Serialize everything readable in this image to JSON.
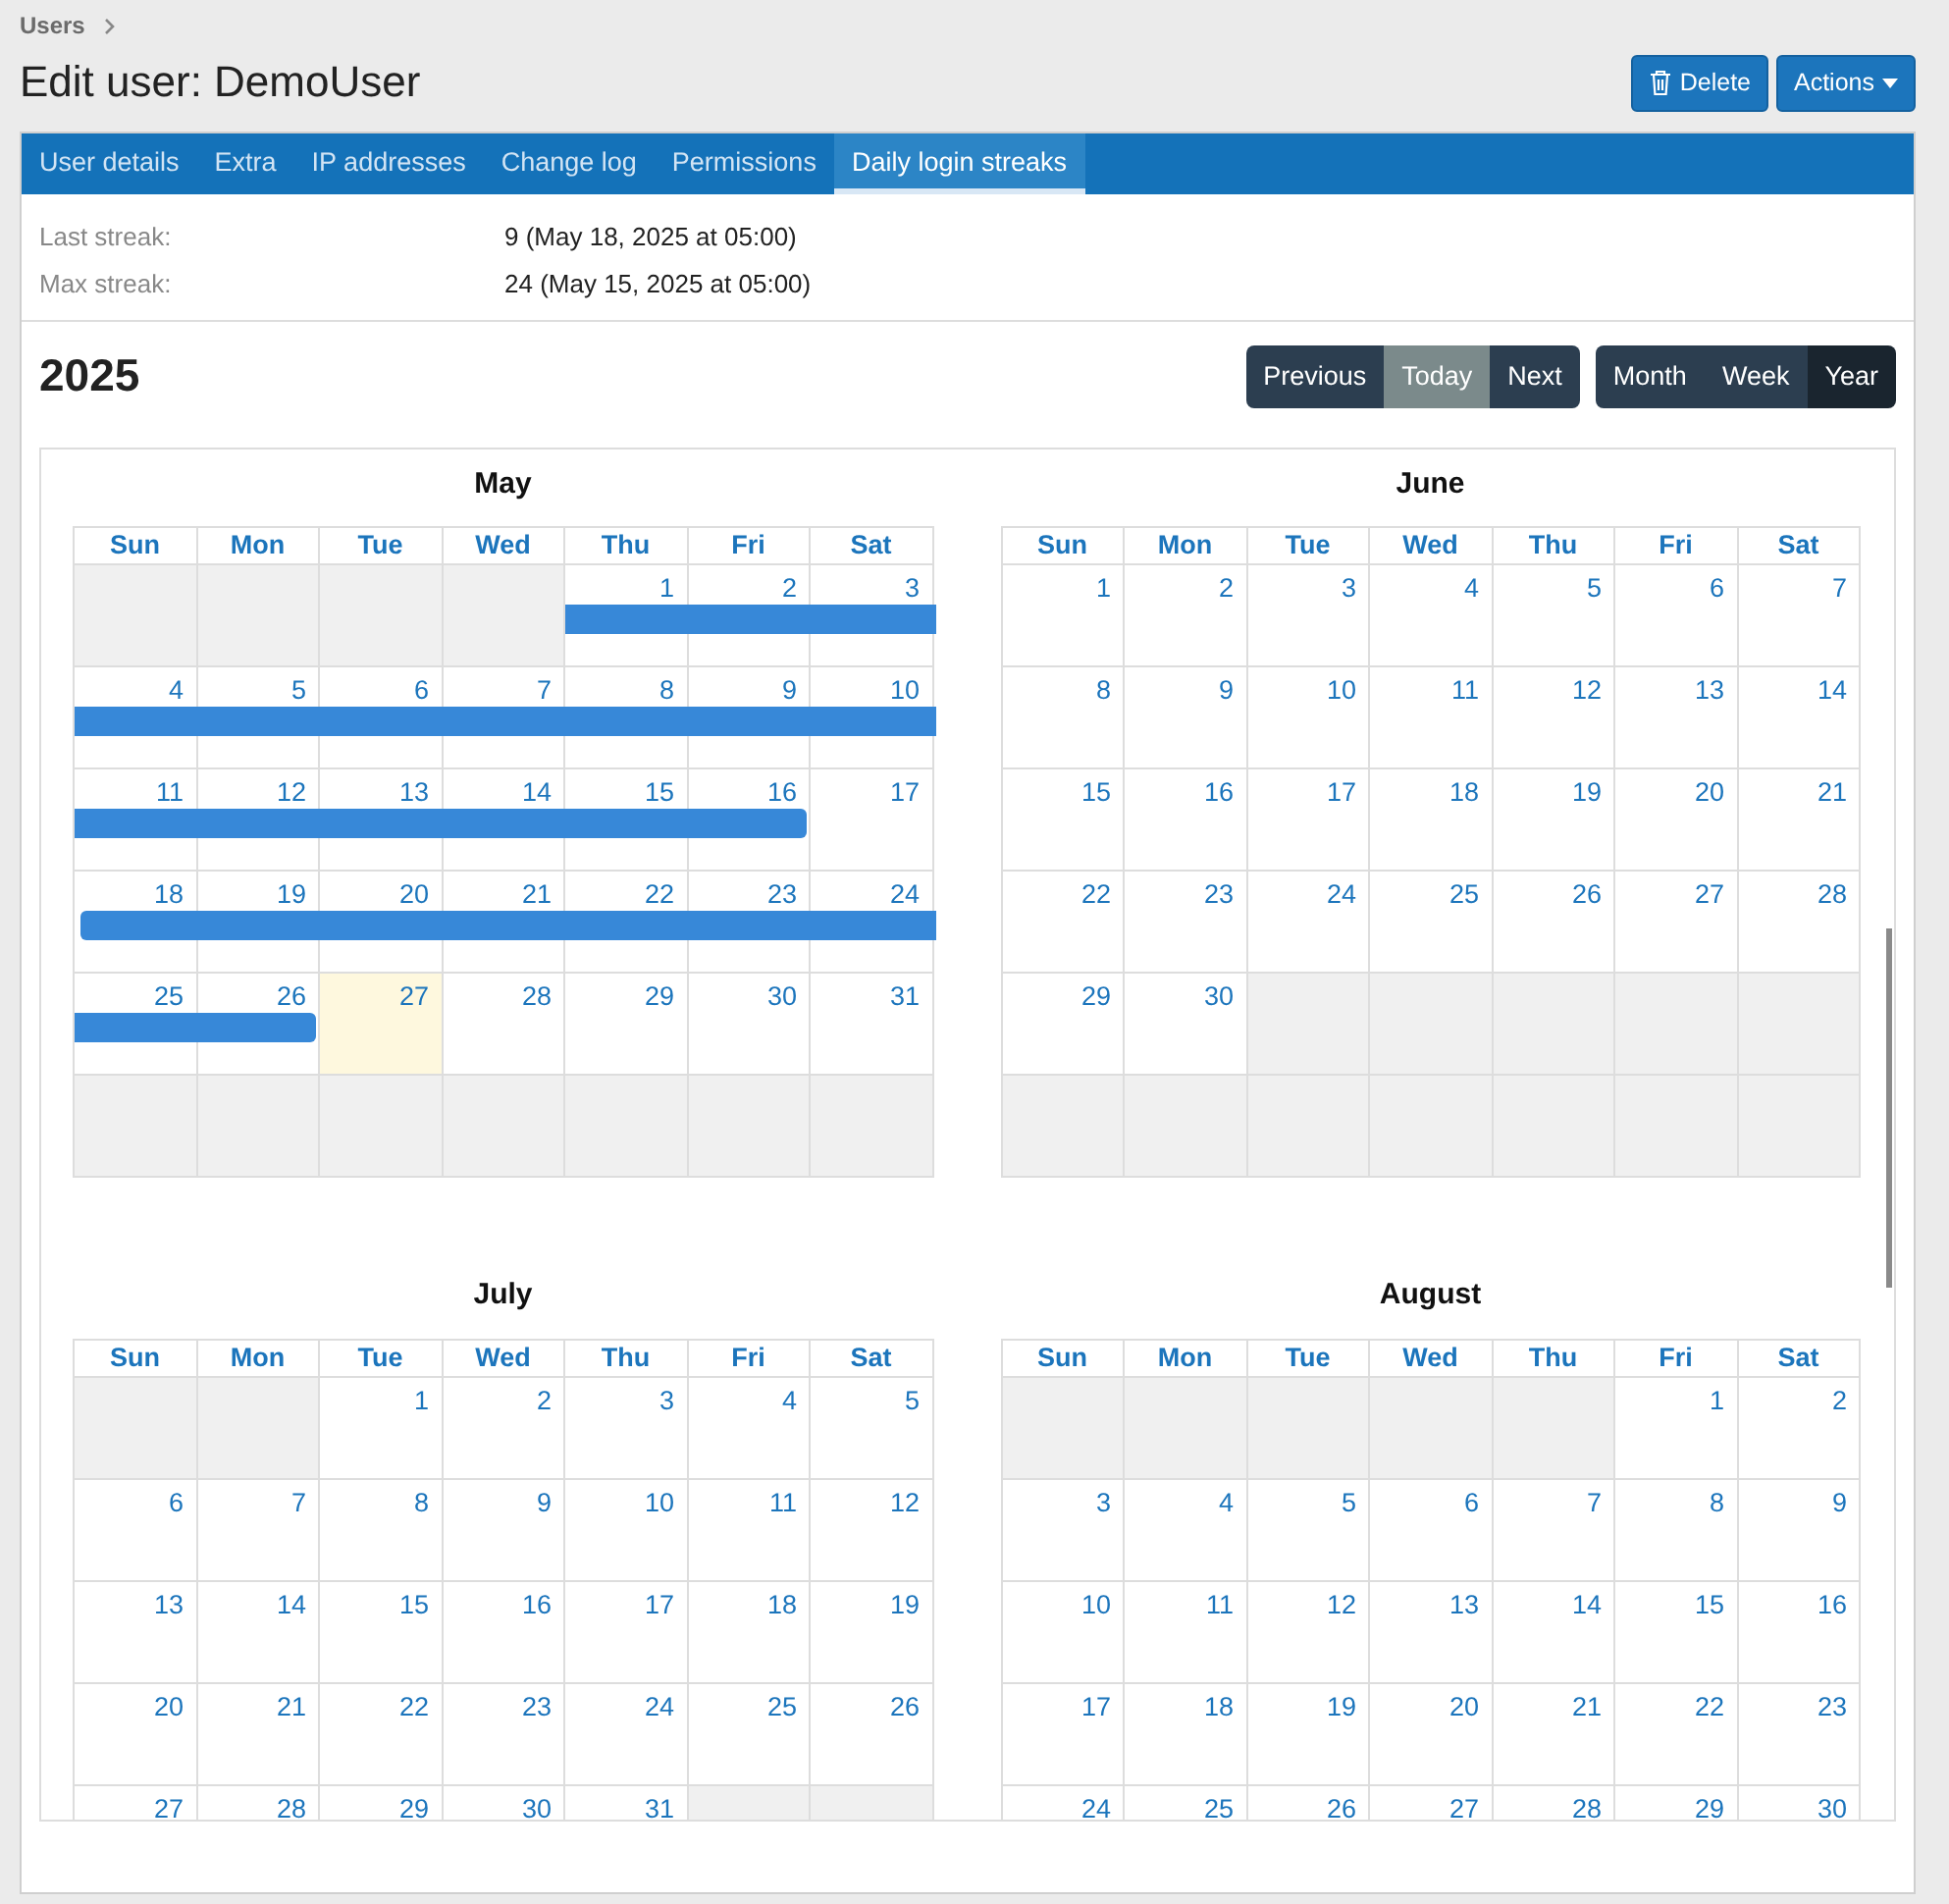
{
  "breadcrumb": {
    "label": "Users"
  },
  "title": "Edit user: DemoUser",
  "header_buttons": [
    {
      "label": "Delete",
      "kind": "delete"
    },
    {
      "label": "Actions",
      "kind": "dropdown"
    }
  ],
  "tabs": [
    {
      "label": "User details",
      "selected": false
    },
    {
      "label": "Extra",
      "selected": false
    },
    {
      "label": "IP addresses",
      "selected": false
    },
    {
      "label": "Change log",
      "selected": false
    },
    {
      "label": "Permissions",
      "selected": false
    },
    {
      "label": "Daily login streaks",
      "selected": true
    }
  ],
  "info": [
    {
      "label": "Last streak:",
      "value": "9 (May 18, 2025 at 05:00)"
    },
    {
      "label": "Max streak:",
      "value": "24 (May 15, 2025 at 05:00)"
    }
  ],
  "calendar": {
    "title": "2025",
    "nav_buttons": [
      {
        "label": "Previous",
        "disabled": false
      },
      {
        "label": "Today",
        "disabled": true
      },
      {
        "label": "Next",
        "disabled": false
      }
    ],
    "view_buttons": [
      {
        "label": "Month",
        "selected": false
      },
      {
        "label": "Week",
        "selected": false
      },
      {
        "label": "Year",
        "selected": true
      }
    ],
    "months": [
      {
        "name": "May",
        "weekdays": [
          "Sun",
          "Mon",
          "Tue",
          "Wed",
          "Thu",
          "Fri",
          "Sat"
        ],
        "weeks": [
          [
            {
              "kind": "blank"
            },
            {
              "kind": "blank"
            },
            {
              "kind": "blank"
            },
            {
              "kind": "blank"
            },
            {
              "kind": "day",
              "day": "1",
              "streak": true,
              "today": false
            },
            {
              "kind": "day",
              "day": "2",
              "streak": true,
              "today": false
            },
            {
              "kind": "day",
              "day": "3",
              "streak": true,
              "today": false
            }
          ],
          [
            {
              "kind": "day",
              "day": "4",
              "streak": true,
              "today": false
            },
            {
              "kind": "day",
              "day": "5",
              "streak": true,
              "today": false
            },
            {
              "kind": "day",
              "day": "6",
              "streak": true,
              "today": false
            },
            {
              "kind": "day",
              "day": "7",
              "streak": true,
              "today": false
            },
            {
              "kind": "day",
              "day": "8",
              "streak": true,
              "today": false
            },
            {
              "kind": "day",
              "day": "9",
              "streak": true,
              "today": false
            },
            {
              "kind": "day",
              "day": "10",
              "streak": true,
              "today": false
            }
          ],
          [
            {
              "kind": "day",
              "day": "11",
              "streak": true,
              "today": false
            },
            {
              "kind": "day",
              "day": "12",
              "streak": true,
              "today": false
            },
            {
              "kind": "day",
              "day": "13",
              "streak": true,
              "today": false
            },
            {
              "kind": "day",
              "day": "14",
              "streak": true,
              "today": false
            },
            {
              "kind": "day",
              "day": "15",
              "streak": true,
              "today": false
            },
            {
              "kind": "day",
              "day": "16",
              "streak": true,
              "today": false
            },
            {
              "kind": "day",
              "day": "17",
              "streak": false,
              "today": false
            }
          ],
          [
            {
              "kind": "day",
              "day": "18",
              "streak": true,
              "today": false
            },
            {
              "kind": "day",
              "day": "19",
              "streak": true,
              "today": false
            },
            {
              "kind": "day",
              "day": "20",
              "streak": true,
              "today": false
            },
            {
              "kind": "day",
              "day": "21",
              "streak": true,
              "today": false
            },
            {
              "kind": "day",
              "day": "22",
              "streak": true,
              "today": false
            },
            {
              "kind": "day",
              "day": "23",
              "streak": true,
              "today": false
            },
            {
              "kind": "day",
              "day": "24",
              "streak": true,
              "today": false
            }
          ],
          [
            {
              "kind": "day",
              "day": "25",
              "streak": true,
              "today": false
            },
            {
              "kind": "day",
              "day": "26",
              "streak": true,
              "today": false
            },
            {
              "kind": "day",
              "day": "27",
              "streak": false,
              "today": true
            },
            {
              "kind": "day",
              "day": "28",
              "streak": false,
              "today": false
            },
            {
              "kind": "day",
              "day": "29",
              "streak": false,
              "today": false
            },
            {
              "kind": "day",
              "day": "30",
              "streak": false,
              "today": false
            },
            {
              "kind": "day",
              "day": "31",
              "streak": false,
              "today": false
            }
          ],
          [
            {
              "kind": "blank"
            },
            {
              "kind": "blank"
            },
            {
              "kind": "blank"
            },
            {
              "kind": "blank"
            },
            {
              "kind": "blank"
            },
            {
              "kind": "blank"
            },
            {
              "kind": "blank"
            }
          ]
        ]
      },
      {
        "name": "June",
        "weekdays": [
          "Sun",
          "Mon",
          "Tue",
          "Wed",
          "Thu",
          "Fri",
          "Sat"
        ],
        "weeks": [
          [
            {
              "kind": "day",
              "day": "1",
              "streak": false,
              "today": false
            },
            {
              "kind": "day",
              "day": "2",
              "streak": false,
              "today": false
            },
            {
              "kind": "day",
              "day": "3",
              "streak": false,
              "today": false
            },
            {
              "kind": "day",
              "day": "4",
              "streak": false,
              "today": false
            },
            {
              "kind": "day",
              "day": "5",
              "streak": false,
              "today": false
            },
            {
              "kind": "day",
              "day": "6",
              "streak": false,
              "today": false
            },
            {
              "kind": "day",
              "day": "7",
              "streak": false,
              "today": false
            }
          ],
          [
            {
              "kind": "day",
              "day": "8",
              "streak": false,
              "today": false
            },
            {
              "kind": "day",
              "day": "9",
              "streak": false,
              "today": false
            },
            {
              "kind": "day",
              "day": "10",
              "streak": false,
              "today": false
            },
            {
              "kind": "day",
              "day": "11",
              "streak": false,
              "today": false
            },
            {
              "kind": "day",
              "day": "12",
              "streak": false,
              "today": false
            },
            {
              "kind": "day",
              "day": "13",
              "streak": false,
              "today": false
            },
            {
              "kind": "day",
              "day": "14",
              "streak": false,
              "today": false
            }
          ],
          [
            {
              "kind": "day",
              "day": "15",
              "streak": false,
              "today": false
            },
            {
              "kind": "day",
              "day": "16",
              "streak": false,
              "today": false
            },
            {
              "kind": "day",
              "day": "17",
              "streak": false,
              "today": false
            },
            {
              "kind": "day",
              "day": "18",
              "streak": false,
              "today": false
            },
            {
              "kind": "day",
              "day": "19",
              "streak": false,
              "today": false
            },
            {
              "kind": "day",
              "day": "20",
              "streak": false,
              "today": false
            },
            {
              "kind": "day",
              "day": "21",
              "streak": false,
              "today": false
            }
          ],
          [
            {
              "kind": "day",
              "day": "22",
              "streak": false,
              "today": false
            },
            {
              "kind": "day",
              "day": "23",
              "streak": false,
              "today": false
            },
            {
              "kind": "day",
              "day": "24",
              "streak": false,
              "today": false
            },
            {
              "kind": "day",
              "day": "25",
              "streak": false,
              "today": false
            },
            {
              "kind": "day",
              "day": "26",
              "streak": false,
              "today": false
            },
            {
              "kind": "day",
              "day": "27",
              "streak": false,
              "today": false
            },
            {
              "kind": "day",
              "day": "28",
              "streak": false,
              "today": false
            }
          ],
          [
            {
              "kind": "day",
              "day": "29",
              "streak": false,
              "today": false
            },
            {
              "kind": "day",
              "day": "30",
              "streak": false,
              "today": false
            },
            {
              "kind": "blank"
            },
            {
              "kind": "blank"
            },
            {
              "kind": "blank"
            },
            {
              "kind": "blank"
            },
            {
              "kind": "blank"
            }
          ],
          [
            {
              "kind": "blank"
            },
            {
              "kind": "blank"
            },
            {
              "kind": "blank"
            },
            {
              "kind": "blank"
            },
            {
              "kind": "blank"
            },
            {
              "kind": "blank"
            },
            {
              "kind": "blank"
            }
          ]
        ]
      },
      {
        "name": "July",
        "weekdays": [
          "Sun",
          "Mon",
          "Tue",
          "Wed",
          "Thu",
          "Fri",
          "Sat"
        ],
        "weeks": [
          [
            {
              "kind": "blank"
            },
            {
              "kind": "blank"
            },
            {
              "kind": "day",
              "day": "1",
              "streak": false,
              "today": false
            },
            {
              "kind": "day",
              "day": "2",
              "streak": false,
              "today": false
            },
            {
              "kind": "day",
              "day": "3",
              "streak": false,
              "today": false
            },
            {
              "kind": "day",
              "day": "4",
              "streak": false,
              "today": false
            },
            {
              "kind": "day",
              "day": "5",
              "streak": false,
              "today": false
            }
          ],
          [
            {
              "kind": "day",
              "day": "6",
              "streak": false,
              "today": false
            },
            {
              "kind": "day",
              "day": "7",
              "streak": false,
              "today": false
            },
            {
              "kind": "day",
              "day": "8",
              "streak": false,
              "today": false
            },
            {
              "kind": "day",
              "day": "9",
              "streak": false,
              "today": false
            },
            {
              "kind": "day",
              "day": "10",
              "streak": false,
              "today": false
            },
            {
              "kind": "day",
              "day": "11",
              "streak": false,
              "today": false
            },
            {
              "kind": "day",
              "day": "12",
              "streak": false,
              "today": false
            }
          ],
          [
            {
              "kind": "day",
              "day": "13",
              "streak": false,
              "today": false
            },
            {
              "kind": "day",
              "day": "14",
              "streak": false,
              "today": false
            },
            {
              "kind": "day",
              "day": "15",
              "streak": false,
              "today": false
            },
            {
              "kind": "day",
              "day": "16",
              "streak": false,
              "today": false
            },
            {
              "kind": "day",
              "day": "17",
              "streak": false,
              "today": false
            },
            {
              "kind": "day",
              "day": "18",
              "streak": false,
              "today": false
            },
            {
              "kind": "day",
              "day": "19",
              "streak": false,
              "today": false
            }
          ],
          [
            {
              "kind": "day",
              "day": "20",
              "streak": false,
              "today": false
            },
            {
              "kind": "day",
              "day": "21",
              "streak": false,
              "today": false
            },
            {
              "kind": "day",
              "day": "22",
              "streak": false,
              "today": false
            },
            {
              "kind": "day",
              "day": "23",
              "streak": false,
              "today": false
            },
            {
              "kind": "day",
              "day": "24",
              "streak": false,
              "today": false
            },
            {
              "kind": "day",
              "day": "25",
              "streak": false,
              "today": false
            },
            {
              "kind": "day",
              "day": "26",
              "streak": false,
              "today": false
            }
          ],
          [
            {
              "kind": "day",
              "day": "27",
              "streak": false,
              "today": false
            },
            {
              "kind": "day",
              "day": "28",
              "streak": false,
              "today": false
            },
            {
              "kind": "day",
              "day": "29",
              "streak": false,
              "today": false
            },
            {
              "kind": "day",
              "day": "30",
              "streak": false,
              "today": false
            },
            {
              "kind": "day",
              "day": "31",
              "streak": false,
              "today": false
            },
            {
              "kind": "blank"
            },
            {
              "kind": "blank"
            }
          ]
        ]
      },
      {
        "name": "August",
        "weekdays": [
          "Sun",
          "Mon",
          "Tue",
          "Wed",
          "Thu",
          "Fri",
          "Sat"
        ],
        "weeks": [
          [
            {
              "kind": "blank"
            },
            {
              "kind": "blank"
            },
            {
              "kind": "blank"
            },
            {
              "kind": "blank"
            },
            {
              "kind": "blank"
            },
            {
              "kind": "day",
              "day": "1",
              "streak": false,
              "today": false
            },
            {
              "kind": "day",
              "day": "2",
              "streak": false,
              "today": false
            }
          ],
          [
            {
              "kind": "day",
              "day": "3",
              "streak": false,
              "today": false
            },
            {
              "kind": "day",
              "day": "4",
              "streak": false,
              "today": false
            },
            {
              "kind": "day",
              "day": "5",
              "streak": false,
              "today": false
            },
            {
              "kind": "day",
              "day": "6",
              "streak": false,
              "today": false
            },
            {
              "kind": "day",
              "day": "7",
              "streak": false,
              "today": false
            },
            {
              "kind": "day",
              "day": "8",
              "streak": false,
              "today": false
            },
            {
              "kind": "day",
              "day": "9",
              "streak": false,
              "today": false
            }
          ],
          [
            {
              "kind": "day",
              "day": "10",
              "streak": false,
              "today": false
            },
            {
              "kind": "day",
              "day": "11",
              "streak": false,
              "today": false
            },
            {
              "kind": "day",
              "day": "12",
              "streak": false,
              "today": false
            },
            {
              "kind": "day",
              "day": "13",
              "streak": false,
              "today": false
            },
            {
              "kind": "day",
              "day": "14",
              "streak": false,
              "today": false
            },
            {
              "kind": "day",
              "day": "15",
              "streak": false,
              "today": false
            },
            {
              "kind": "day",
              "day": "16",
              "streak": false,
              "today": false
            }
          ],
          [
            {
              "kind": "day",
              "day": "17",
              "streak": false,
              "today": false
            },
            {
              "kind": "day",
              "day": "18",
              "streak": false,
              "today": false
            },
            {
              "kind": "day",
              "day": "19",
              "streak": false,
              "today": false
            },
            {
              "kind": "day",
              "day": "20",
              "streak": false,
              "today": false
            },
            {
              "kind": "day",
              "day": "21",
              "streak": false,
              "today": false
            },
            {
              "kind": "day",
              "day": "22",
              "streak": false,
              "today": false
            },
            {
              "kind": "day",
              "day": "23",
              "streak": false,
              "today": false
            }
          ],
          [
            {
              "kind": "day",
              "day": "24",
              "streak": false,
              "today": false
            },
            {
              "kind": "day",
              "day": "25",
              "streak": false,
              "today": false
            },
            {
              "kind": "day",
              "day": "26",
              "streak": false,
              "today": false
            },
            {
              "kind": "day",
              "day": "27",
              "streak": false,
              "today": false
            },
            {
              "kind": "day",
              "day": "28",
              "streak": false,
              "today": false
            },
            {
              "kind": "day",
              "day": "29",
              "streak": false,
              "today": false
            },
            {
              "kind": "day",
              "day": "30",
              "streak": false,
              "today": false
            }
          ]
        ]
      }
    ]
  }
}
